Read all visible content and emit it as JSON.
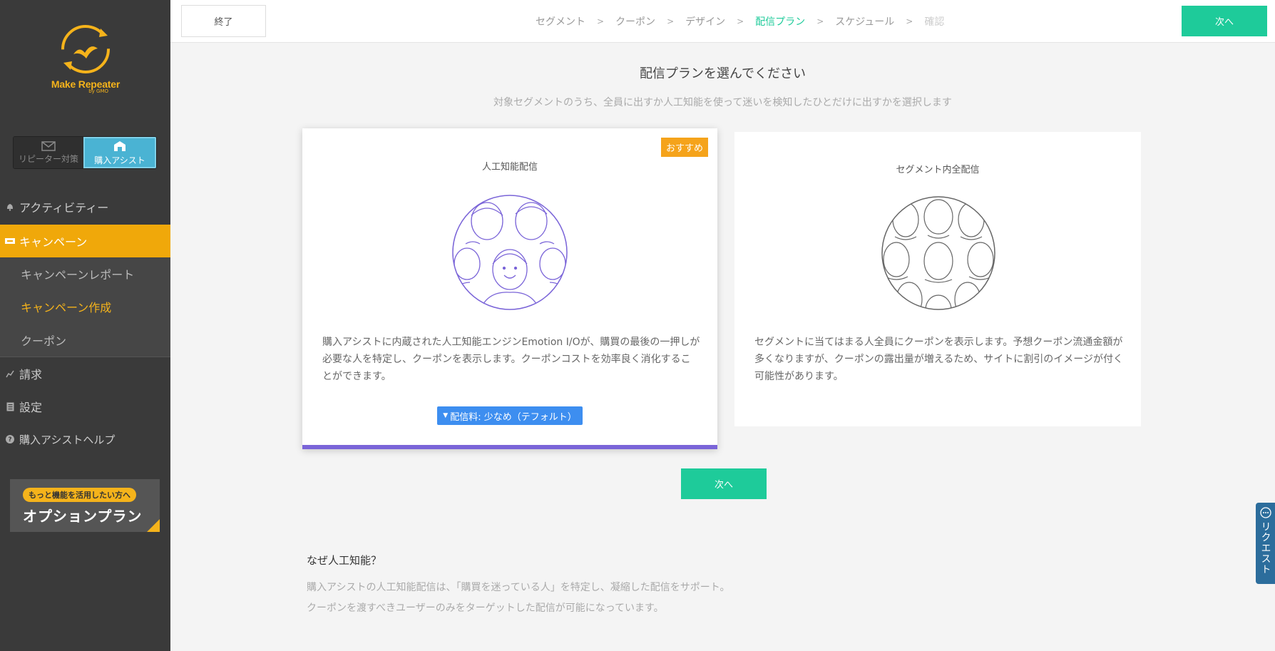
{
  "brand": {
    "name": "Make Repeater",
    "sub": "by GMO"
  },
  "mode_switch": {
    "off_label": "リピーター対策",
    "on_label": "購入アシスト"
  },
  "sidebar": {
    "items": [
      {
        "label": "アクティビティー",
        "icon": "bell-icon"
      },
      {
        "label": "キャンペーン",
        "icon": "ticket-icon"
      },
      {
        "label": "キャンペーンレポート"
      },
      {
        "label": "キャンペーン作成"
      },
      {
        "label": "クーポン"
      },
      {
        "label": "請求",
        "icon": "chart-line-icon"
      },
      {
        "label": "設定",
        "icon": "document-icon"
      },
      {
        "label": "購入アシストヘルプ",
        "icon": "help-circle-icon"
      }
    ]
  },
  "option_plan": {
    "pill": "もっと機能を活用したい方へ",
    "title": "オプションプラン"
  },
  "header": {
    "quit_label": "終了",
    "steps": [
      "セグメント",
      "クーポン",
      "デザイン",
      "配信プラン",
      "スケジュール",
      "確認"
    ],
    "separator": ">",
    "next_label": "次へ"
  },
  "main": {
    "title": "配信プランを選んでください",
    "subtitle": "対象セグメントのうち、全員に出すか人工知能を使って迷いを検知したひとだけに出すかを選択します",
    "next_label": "次へ"
  },
  "cards": {
    "ai": {
      "badge": "おすすめ",
      "title": "人工知能配信",
      "desc": "購入アシストに内蔵された人工知能エンジンEmotion I/Oが、購買の最後の一押しが必要な人を特定し、クーポンを表示します。クーポンコストを効率良く消化することができます。",
      "fee_button": "配信料: 少なめ（テフォルト）"
    },
    "all": {
      "title": "セグメント内全配信",
      "desc": "セグメントに当てはまる人全員にクーポンを表示します。予想クーポン流通金額が多くなりますが、クーポンの露出量が増えるため、サイトに割引のイメージが付く可能性があります。"
    }
  },
  "why": {
    "title": "なぜ人工知能？",
    "lines": [
      "購入アシストの人工知能配信は、「購買を迷っている人」を特定し、凝縮した配信をサポート。",
      "クーポンを渡すべきユーザーのみをターゲットした配信が可能になっています。"
    ]
  },
  "request_tab": {
    "label": "リクエスト"
  },
  "colors": {
    "accent": "#1ecb9a",
    "orange": "#f0a80a",
    "purple": "#7a64d8",
    "blue": "#3d8ef0",
    "sidebar": "#3a3a3a"
  }
}
